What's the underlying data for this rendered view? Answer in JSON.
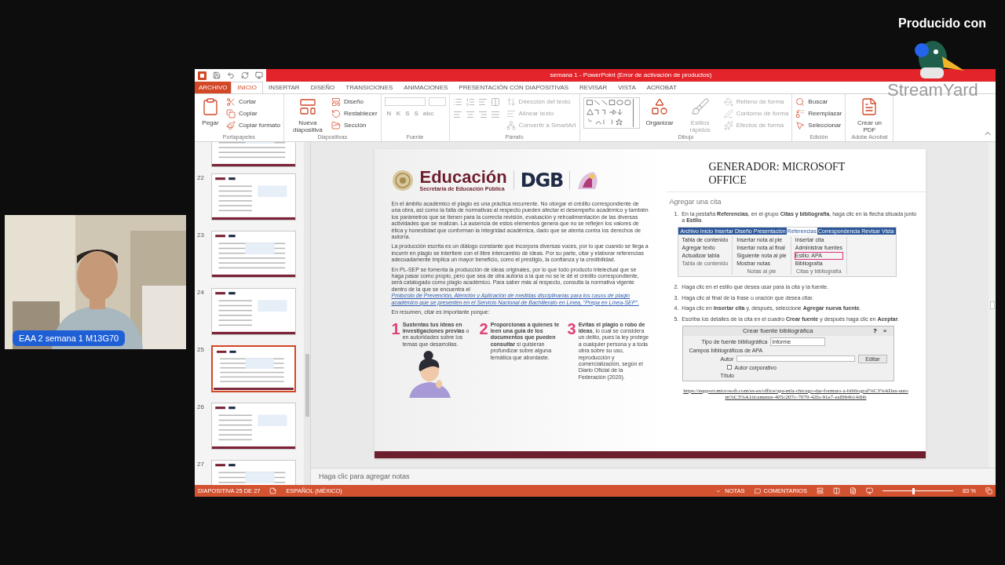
{
  "stream": {
    "produced_by": "Producido con",
    "brand": "StreamYard"
  },
  "camera": {
    "label": "EAA 2 semana 1 M13G70"
  },
  "window": {
    "title": "semana 1 - PowerPoint (Error de activación de productos)"
  },
  "tabs": [
    {
      "label": "ARCHIVO",
      "kind": "file",
      "selected": false
    },
    {
      "label": "INICIO",
      "kind": "tab",
      "selected": true
    },
    {
      "label": "INSERTAR",
      "kind": "tab",
      "selected": false
    },
    {
      "label": "DISEÑO",
      "kind": "tab",
      "selected": false
    },
    {
      "label": "TRANSICIONES",
      "kind": "tab",
      "selected": false
    },
    {
      "label": "ANIMACIONES",
      "kind": "tab",
      "selected": false
    },
    {
      "label": "PRESENTACIÓN CON DIAPOSITIVAS",
      "kind": "tab",
      "selected": false
    },
    {
      "label": "REVISAR",
      "kind": "tab",
      "selected": false
    },
    {
      "label": "VISTA",
      "kind": "tab",
      "selected": false
    },
    {
      "label": "ACROBAT",
      "kind": "tab",
      "selected": false
    }
  ],
  "ribbon": [
    {
      "name": "Portapapeles",
      "kind": "standard",
      "items": [
        {
          "label": "Pegar",
          "kind": "large",
          "disabled": false
        },
        {
          "label": "Cortar",
          "kind": "small",
          "disabled": false
        },
        {
          "label": "Copiar",
          "kind": "small",
          "disabled": false
        },
        {
          "label": "Copiar formato",
          "kind": "small",
          "disabled": false
        }
      ]
    },
    {
      "name": "Diapositivas",
      "kind": "standard",
      "items": [
        {
          "label": "Nueva diapositiva",
          "kind": "large",
          "disabled": false
        },
        {
          "label": "Diseño",
          "kind": "small",
          "disabled": false
        },
        {
          "label": "Restablecer",
          "kind": "small",
          "disabled": false
        },
        {
          "label": "Sección",
          "kind": "small",
          "disabled": false
        }
      ]
    },
    {
      "name": "Fuente",
      "kind": "font",
      "items": [
        {
          "label": "N",
          "kind": "format",
          "disabled": true
        },
        {
          "label": "K",
          "kind": "format",
          "disabled": true
        },
        {
          "label": "S",
          "kind": "format",
          "disabled": true
        },
        {
          "label": "S",
          "kind": "format",
          "disabled": true
        },
        {
          "label": "abc",
          "kind": "format",
          "disabled": true
        }
      ]
    },
    {
      "name": "Párrafo",
      "kind": "paragraph",
      "items": [
        {
          "label": "Dirección del texto",
          "kind": "small",
          "disabled": true
        },
        {
          "label": "Alinear texto",
          "kind": "small",
          "disabled": true
        },
        {
          "label": "Convertir a SmartArt",
          "kind": "small",
          "disabled": true
        }
      ]
    },
    {
      "name": "Dibujo",
      "kind": "shapes",
      "items": [
        {
          "label": "Organizar",
          "kind": "large",
          "disabled": false
        },
        {
          "label": "Estilos rápidos",
          "kind": "large",
          "disabled": true
        },
        {
          "label": "Relleno de forma",
          "kind": "small",
          "disabled": true
        },
        {
          "label": "Contorno de forma",
          "kind": "small",
          "disabled": true
        },
        {
          "label": "Efectos de forma",
          "kind": "small",
          "disabled": true
        }
      ]
    },
    {
      "name": "Edición",
      "kind": "standard",
      "items": [
        {
          "label": "Buscar",
          "kind": "small",
          "disabled": false
        },
        {
          "label": "Reemplazar",
          "kind": "small",
          "disabled": false
        },
        {
          "label": "Seleccionar",
          "kind": "small",
          "disabled": false
        }
      ]
    },
    {
      "name": "Adobe Acrobat",
      "kind": "standard",
      "items": [
        {
          "label": "Crear un PDF",
          "kind": "large",
          "disabled": false
        }
      ]
    }
  ],
  "thumbnails": [
    {
      "selected": false
    },
    {
      "number": "22",
      "selected": false
    },
    {
      "number": "23",
      "selected": false
    },
    {
      "number": "24",
      "selected": false
    },
    {
      "number": "25",
      "selected": true
    },
    {
      "number": "26",
      "selected": false
    },
    {
      "number": "27",
      "selected": false
    }
  ],
  "slide": {
    "logo": {
      "name": "Educación",
      "subtitle": "Secretaría de Educación Pública",
      "partner": "DGB"
    },
    "paragraphs": [
      {
        "text": "En el ámbito académico el plagio es una práctica recurrente. No otorgar el crédito correspondiente de una obra, así como la falta de normativas al respecto pueden afectar el desempeño académico y también los parámetros que se tienen para la correcta revisión, evaluación y retroalimentación de las diversas actividades que se realizan. La ausencia de estos elementos genera que no se reflejen los valores de ética y honestidad que conforman la integridad académica, dado que se atenta contra los derechos de autoría."
      },
      {
        "text": "La producción escrita es un diálogo constante que incorpora diversas voces, por lo que cuando se llega a incurrir en plagio se interfiere con el libre intercambio de ideas. Por su parte, citar y elaborar referencias adecuadamente implica un mayor beneficio, como el prestigio, la confianza y la credibilidad."
      },
      {
        "text": "En PL-SEP se fomenta la producción de ideas originales, por lo que todo producto intelectual que se haga pasar como propio, pero que sea de otra autoría a la que no se le dé el crédito correspondiente, será catalogado como plagio académico. Para saber más al respecto, consulta la normativa vigente dentro de la que se encuentra el",
        "link": "Protocolo de Prevención, Atención y Aplicación de medidas disciplinarias para los casos de plagio académico que se presenten en el Servicio Nacional de Bachillerato en Línea, “Prepa en Línea-SEP”."
      },
      {
        "text": "En resumen, citar es importante porque:"
      }
    ],
    "reasons": [
      {
        "number": "1",
        "text": "**Sustentas tus ideas en investigaciones previas** o en autoridades sobre los temas que desarrollas."
      },
      {
        "number": "2",
        "text": "**Proporcionas a quienes te leen una guía de los documentos que pueden consultar** si quisieran profundizar sobre alguna temática que abordaste."
      },
      {
        "number": "3",
        "text": "**Evitas el plagio o robo de ideas**, lo cual se considera un delito, pues la ley protege a cualquier persona y a toda obra sobre su uso, reproducción y comercialización, según el Diario Oficial de la Federación (2020)."
      }
    ],
    "title": "GENERADOR: MICROSOFT OFFICE",
    "subtitle": "Agregar una cita",
    "steps": [
      {
        "number": "1.",
        "text": "En la pestaña **Referencias**, en el grupo **Citas y bibliografía**, haga clic en la flecha situada junto a **Estilo**.",
        "figure": {
          "kind": "ribbon",
          "tabs": [
            {
              "label": "Archivo",
              "selected": false
            },
            {
              "label": "Inicio",
              "selected": false
            },
            {
              "label": "Insertar",
              "selected": false
            },
            {
              "label": "Diseño",
              "selected": false
            },
            {
              "label": "Presentación",
              "selected": false
            },
            {
              "label": "Referencias",
              "selected": true
            },
            {
              "label": "Correspondencia",
              "selected": false
            },
            {
              "label": "Revisar",
              "selected": false
            },
            {
              "label": "Vista",
              "selected": false
            }
          ],
          "groups": [
            {
              "name": "Tabla de contenido",
              "items": [
                {
                  "label": "Tabla de contenido",
                  "highlighted": false
                },
                {
                  "label": "Agregar texto",
                  "highlighted": false
                },
                {
                  "label": "Actualizar tabla",
                  "highlighted": false
                }
              ]
            },
            {
              "name": "Notas al pie",
              "items": [
                {
                  "label": "Insertar nota al pie",
                  "highlighted": false
                },
                {
                  "label": "Insertar nota al final",
                  "highlighted": false
                },
                {
                  "label": "Siguiente nota al pie",
                  "highlighted": false
                },
                {
                  "label": "Mostrar notas",
                  "highlighted": false
                }
              ]
            },
            {
              "name": "Citas y bibliografía",
              "items": [
                {
                  "label": "Insertar cita",
                  "highlighted": false
                },
                {
                  "label": "Administrar fuentes",
                  "highlighted": false
                },
                {
                  "label": "Estilo: APA",
                  "highlighted": true
                },
                {
                  "label": "Bibliografía",
                  "highlighted": false
                }
              ]
            }
          ]
        }
      },
      {
        "number": "2.",
        "text": "Haga clic en el estilo que desea usar para la cita y la fuente."
      },
      {
        "number": "3.",
        "text": "Haga clic al final de la frase u oración que desea citar."
      },
      {
        "number": "4.",
        "text": "Haga clic en **Insertar cita** y, después, seleccione **Agregar nueva fuente**."
      },
      {
        "number": "5.",
        "text": "Escriba los detalles de la cita en el cuadro **Crear fuente** y después haga clic en **Aceptar**.",
        "figure": {
          "kind": "dialog",
          "title": "Crear fuente bibliográfica",
          "help": "?",
          "close": "×",
          "type_label": "Tipo de fuente bibliográfica",
          "type_value": "Informe",
          "fields_label": "Campos bibliográficos de APA",
          "author_label": "Autor",
          "edit_button": "Editar",
          "corporate": {
            "label": "Autor corporativo",
            "checked": false
          },
          "title_label": "Título"
        }
      }
    ],
    "url": "https://support.microsoft.com/es-es/office/apa-mla-chicago-dar-formato-a-bibliograf%C3%ADas-autom%C3%A1ticamente-405c207c-7070-42fa-91e7-eaf064b14dbb"
  },
  "notes": {
    "placeholder": "Haga clic para agregar notas"
  },
  "status_bar": {
    "slide": "DIAPOSITIVA 25 DE 27",
    "language": "ESPAÑOL (MÉXICO)",
    "notes": "NOTAS",
    "comments": "COMENTARIOS",
    "zoom": "83 %",
    "level": 0.42
  }
}
